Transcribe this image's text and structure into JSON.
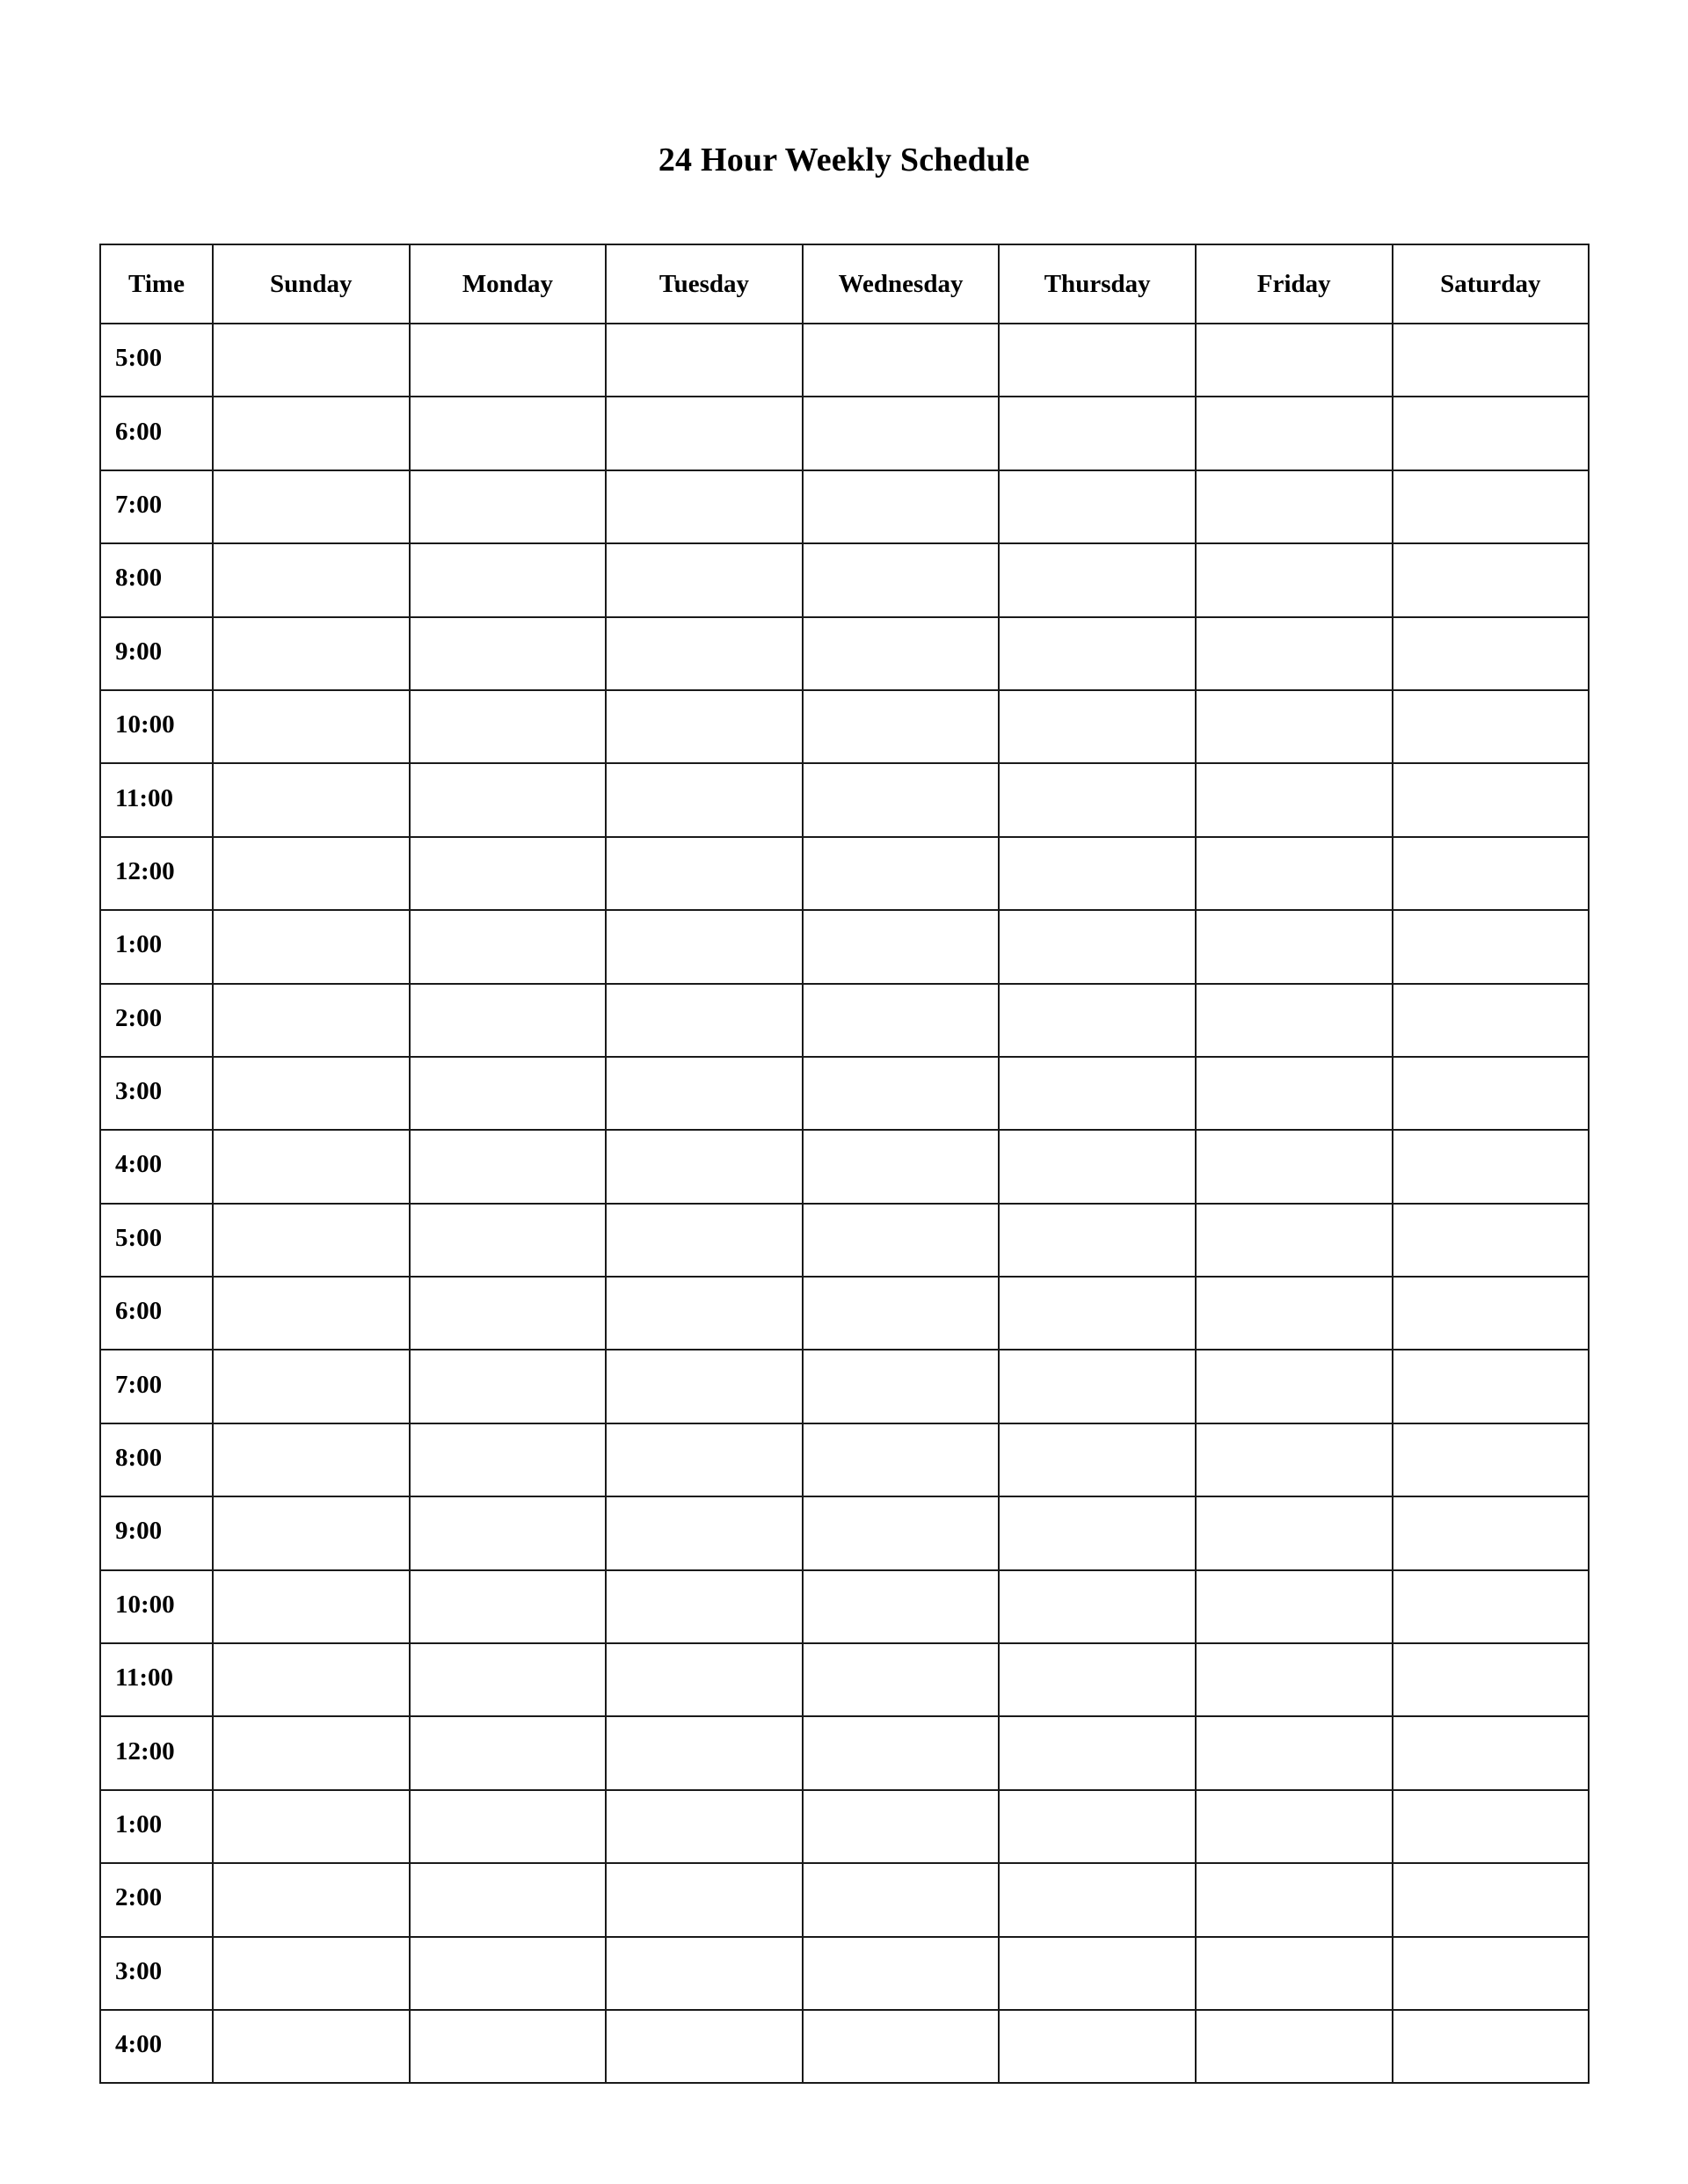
{
  "document": {
    "title": "24 Hour Weekly Schedule",
    "background_color": "#ffffff",
    "ink_color": "#1a1a1a"
  },
  "table": {
    "headers": [
      "Time",
      "Sunday",
      "Monday",
      "Tuesday",
      "Wednesday",
      "Thursday",
      "Friday",
      "Saturday"
    ],
    "time_column_header": "Time",
    "day_columns": [
      "Sunday",
      "Monday",
      "Tuesday",
      "Wednesday",
      "Thursday",
      "Friday",
      "Saturday"
    ],
    "rows": [
      {
        "time": "5:00",
        "cells": [
          "",
          "",
          "",
          "",
          "",
          "",
          ""
        ]
      },
      {
        "time": "6:00",
        "cells": [
          "",
          "",
          "",
          "",
          "",
          "",
          ""
        ]
      },
      {
        "time": "7:00",
        "cells": [
          "",
          "",
          "",
          "",
          "",
          "",
          ""
        ]
      },
      {
        "time": "8:00",
        "cells": [
          "",
          "",
          "",
          "",
          "",
          "",
          ""
        ]
      },
      {
        "time": "9:00",
        "cells": [
          "",
          "",
          "",
          "",
          "",
          "",
          ""
        ]
      },
      {
        "time": "10:00",
        "cells": [
          "",
          "",
          "",
          "",
          "",
          "",
          ""
        ]
      },
      {
        "time": "11:00",
        "cells": [
          "",
          "",
          "",
          "",
          "",
          "",
          ""
        ]
      },
      {
        "time": "12:00",
        "cells": [
          "",
          "",
          "",
          "",
          "",
          "",
          ""
        ]
      },
      {
        "time": "1:00",
        "cells": [
          "",
          "",
          "",
          "",
          "",
          "",
          ""
        ]
      },
      {
        "time": "2:00",
        "cells": [
          "",
          "",
          "",
          "",
          "",
          "",
          ""
        ]
      },
      {
        "time": "3:00",
        "cells": [
          "",
          "",
          "",
          "",
          "",
          "",
          ""
        ]
      },
      {
        "time": "4:00",
        "cells": [
          "",
          "",
          "",
          "",
          "",
          "",
          ""
        ]
      },
      {
        "time": "5:00",
        "cells": [
          "",
          "",
          "",
          "",
          "",
          "",
          ""
        ]
      },
      {
        "time": "6:00",
        "cells": [
          "",
          "",
          "",
          "",
          "",
          "",
          ""
        ]
      },
      {
        "time": "7:00",
        "cells": [
          "",
          "",
          "",
          "",
          "",
          "",
          ""
        ]
      },
      {
        "time": "8:00",
        "cells": [
          "",
          "",
          "",
          "",
          "",
          "",
          ""
        ]
      },
      {
        "time": "9:00",
        "cells": [
          "",
          "",
          "",
          "",
          "",
          "",
          ""
        ]
      },
      {
        "time": "10:00",
        "cells": [
          "",
          "",
          "",
          "",
          "",
          "",
          ""
        ]
      },
      {
        "time": "11:00",
        "cells": [
          "",
          "",
          "",
          "",
          "",
          "",
          ""
        ]
      },
      {
        "time": "12:00",
        "cells": [
          "",
          "",
          "",
          "",
          "",
          "",
          ""
        ]
      },
      {
        "time": "1:00",
        "cells": [
          "",
          "",
          "",
          "",
          "",
          "",
          ""
        ]
      },
      {
        "time": "2:00",
        "cells": [
          "",
          "",
          "",
          "",
          "",
          "",
          ""
        ]
      },
      {
        "time": "3:00",
        "cells": [
          "",
          "",
          "",
          "",
          "",
          "",
          ""
        ]
      },
      {
        "time": "4:00",
        "cells": [
          "",
          "",
          "",
          "",
          "",
          "",
          ""
        ]
      }
    ]
  }
}
